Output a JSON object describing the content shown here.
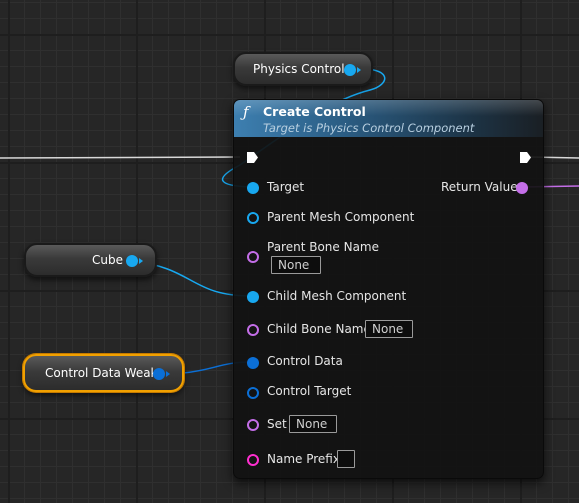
{
  "graph": {
    "physics_control_node": {
      "label": "Physics Control"
    },
    "cube_node": {
      "label": "Cube"
    },
    "control_data_weak_node": {
      "label": "Control Data Weak"
    },
    "create_control_node": {
      "title": "Create Control",
      "subtitle": "Target is Physics Control Component",
      "inputs": {
        "target": "Target",
        "parent_mesh_component": "Parent Mesh Component",
        "parent_bone_name": "Parent Bone Name",
        "parent_bone_name_value": "None",
        "child_mesh_component": "Child Mesh Component",
        "child_bone_name": "Child Bone Name",
        "child_bone_name_value": "None",
        "control_data": "Control Data",
        "control_target": "Control Target",
        "set": "Set",
        "set_value": "None",
        "name_prefix": "Name Prefix",
        "name_prefix_value": ""
      },
      "outputs": {
        "return_value": "Return Value"
      }
    }
  },
  "colors": {
    "object_pin": "#18a8f0",
    "struct_pin": "#0b6fd6",
    "name_pin": "#c46ee8",
    "string_pin": "#ff2fd0",
    "selection_outline": "#f2a100"
  }
}
